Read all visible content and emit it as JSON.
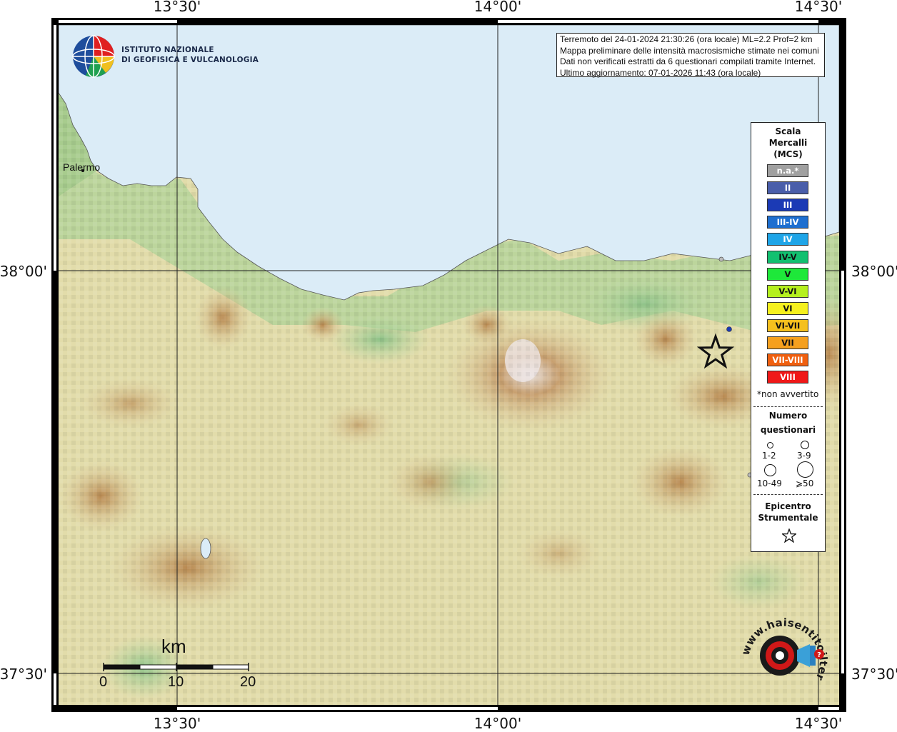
{
  "axes": {
    "top_ticks": [
      "13°30'",
      "14°00'",
      "14°30'"
    ],
    "bottom_ticks": [
      "13°30'",
      "14°00'",
      "14°30'"
    ],
    "left_ticks": [
      "38°00'",
      "37°30'"
    ],
    "right_ticks": [
      "38°00'",
      "37°30'"
    ]
  },
  "logo_ingv": {
    "line1": "ISTITUTO NAZIONALE",
    "line2": "DI GEOFISICA E VULCANOLOGIA"
  },
  "info": {
    "line1": "Terremoto del 24-01-2024 21:30:26 (ora locale) ML=2.2 Prof=2 km",
    "line2": "Mappa preliminare delle intensità macrosismiche stimate nei comuni",
    "line3": "Dati non verificati estratti da 6 questionari compilati tramite Internet.",
    "line4": "Ultimo aggiornamento: 07-01-2026 11:43 (ora locale)"
  },
  "places": {
    "palermo": "Palermo"
  },
  "legend": {
    "title1": "Scala",
    "title2": "Mercalli",
    "title3": "(MCS)",
    "classes": [
      {
        "label": "n.a.*",
        "color": "#a0a0a0",
        "text": "#ffffff"
      },
      {
        "label": "II",
        "color": "#4a5eaa",
        "text": "#ffffff"
      },
      {
        "label": "III",
        "color": "#1b3ab5",
        "text": "#ffffff"
      },
      {
        "label": "III-IV",
        "color": "#1e6fd0",
        "text": "#ffffff"
      },
      {
        "label": "IV",
        "color": "#1ea5e8",
        "text": "#ffffff"
      },
      {
        "label": "IV-V",
        "color": "#12c070",
        "text": "#111111"
      },
      {
        "label": "V",
        "color": "#1ee83a",
        "text": "#111111"
      },
      {
        "label": "V-VI",
        "color": "#b5f01e",
        "text": "#111111"
      },
      {
        "label": "VI",
        "color": "#f5f01e",
        "text": "#111111"
      },
      {
        "label": "VI-VII",
        "color": "#f5c01e",
        "text": "#111111"
      },
      {
        "label": "VII",
        "color": "#f5a01e",
        "text": "#111111"
      },
      {
        "label": "VII-VIII",
        "color": "#f06010",
        "text": "#ffffff"
      },
      {
        "label": "VIII",
        "color": "#f01818",
        "text": "#ffffff"
      }
    ],
    "not_felt_note": "*non avvertito",
    "count_title1": "Numero",
    "count_title2": "questionari",
    "count_sizes": [
      "1-2",
      "3-9",
      "10-49",
      "⩾50"
    ],
    "epicenter_title1": "Epicentro",
    "epicenter_title2": "Strumentale"
  },
  "scale_bar": {
    "unit": "km",
    "labels": [
      "0",
      "10",
      "20"
    ]
  },
  "hai_logo": {
    "text": "www.haisentitoilterremoto.it"
  }
}
